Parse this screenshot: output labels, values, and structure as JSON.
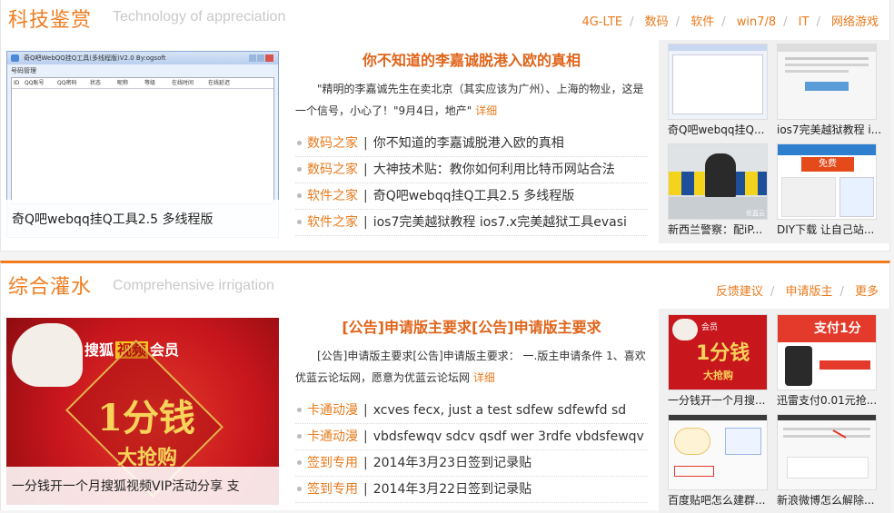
{
  "section1": {
    "title_cn": "科技鉴赏",
    "title_en": "Technology of appreciation",
    "nav": [
      "4G-LTE",
      "数码",
      "软件",
      "win7/8",
      "IT",
      "网络游戏"
    ],
    "feature": {
      "caption": "奇Q吧webqq挂Q工具2.5 多线程版",
      "app_title": "奇Q吧WebQQ挂Q工具(多线程版)V2.0     By:ogsoft",
      "app_tab": "号码管理",
      "app_columns": [
        "ID",
        "QQ账号",
        "QQ密码",
        "状态",
        "昵称",
        "等级",
        "在线时间",
        "在线延迟"
      ]
    },
    "article": {
      "title": "你不知道的李嘉诚脱港入欧的真相",
      "summary": "\"精明的李嘉诚先生在卖北京（其实应该为广州）、上海的物业，这是一个信号，小心了！\"9月4日，地产\"",
      "more": "详细",
      "items": [
        {
          "cat": "数码之家",
          "text": "你不知道的李嘉诚脱港入欧的真相"
        },
        {
          "cat": "数码之家",
          "text": "大神技术贴：教你如何利用比特币网站合法"
        },
        {
          "cat": "软件之家",
          "text": "奇Q吧webqq挂Q工具2.5 多线程版"
        },
        {
          "cat": "软件之家",
          "text": "ios7完美越狱教程 ios7.x完美越狱工具evasi"
        }
      ]
    },
    "thumbs": [
      {
        "caption": "奇Q吧webqq挂Q..."
      },
      {
        "caption": "ios7完美越狱教程 i..."
      },
      {
        "caption": "新西兰警察：配iP..."
      },
      {
        "caption": "DIY下载 让自己站..."
      }
    ],
    "thumb_text": {
      "free": "免费",
      "watermark": "优蓝云"
    }
  },
  "section2": {
    "title_cn": "综合灌水",
    "title_en": "Comprehensive irrigation",
    "nav": [
      "反馈建议",
      "申请版主",
      "更多"
    ],
    "feature": {
      "caption": "一分钱开一个月搜狐视频VIP活动分享 支",
      "banner_brand": "搜狐",
      "banner_badge": "视频",
      "banner_member": "会员",
      "banner_big": "1分钱",
      "banner_rush": "大抢购"
    },
    "article": {
      "title": "[公告]申请版主要求[公告]申请版主要求",
      "summary": "[公告]申请版主要求[公告]申请版主要求： 一.版主申请条件 1、喜欢优蓝云论坛网，愿意为优蓝云论坛网",
      "more": "详细",
      "items": [
        {
          "cat": "卡通动漫",
          "text": "xcves fecx, just a test sdfew sdfewfd sd"
        },
        {
          "cat": "卡通动漫",
          "text": "vbdsfewqv sdcv qsdf wer 3rdfe vbdsfewqv"
        },
        {
          "cat": "签到专用",
          "text": "2014年3月23日签到记录贴"
        },
        {
          "cat": "签到专用",
          "text": "2014年3月22日签到记录贴"
        }
      ]
    },
    "thumbs": [
      {
        "caption": "一分钱开一个月搜..."
      },
      {
        "caption": "迅雷支付0.01元抢..."
      },
      {
        "caption": "百度贴吧怎么建群..."
      },
      {
        "caption": "新浪微博怎么解除..."
      }
    ],
    "thumb_text": {
      "pay": "支付1分",
      "small_member": "会员",
      "small_big": "1分钱",
      "small_rush": "大抢购"
    }
  },
  "colors": {
    "accent": "#f07c1f",
    "link": "#e87a1c",
    "title_red": "#e0641a",
    "banner_red": "#c8161d"
  }
}
